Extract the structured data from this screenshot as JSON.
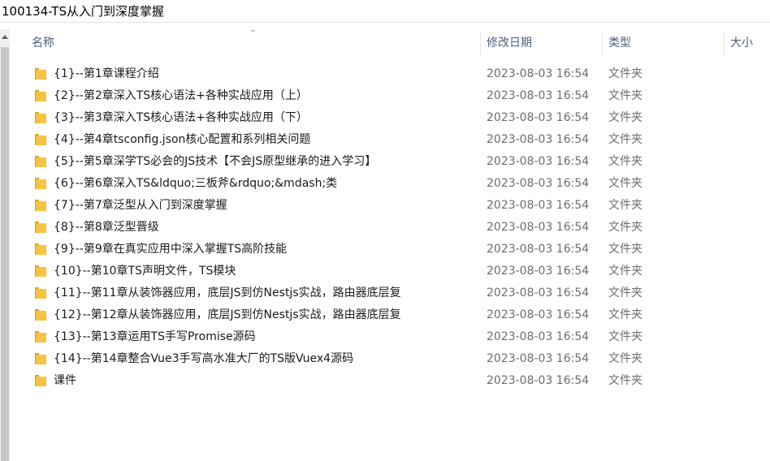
{
  "window": {
    "title": "100134-TS从入门到深度掌握"
  },
  "columns": {
    "name": "名称",
    "modified": "修改日期",
    "type": "类型",
    "size": "大小"
  },
  "colors": {
    "folder": "#f6c343",
    "folder_tab": "#e3a21a",
    "header_text": "#4c607a"
  },
  "icons": {
    "folder": "folder-icon",
    "sort": "sort-ascending-icon",
    "scroll_up": "scroll-up-arrow-icon"
  },
  "items": [
    {
      "name": "{1}--第1章课程介绍",
      "modified": "2023-08-03 16:54",
      "type": "文件夹"
    },
    {
      "name": "{2}--第2章深入TS核心语法+各种实战应用（上）",
      "modified": "2023-08-03 16:54",
      "type": "文件夹"
    },
    {
      "name": "{3}--第3章深入TS核心语法+各种实战应用（下）",
      "modified": "2023-08-03 16:54",
      "type": "文件夹"
    },
    {
      "name": "{4}--第4章tsconfig.json核心配置和系列相关问题",
      "modified": "2023-08-03 16:54",
      "type": "文件夹"
    },
    {
      "name": "{5}--第5章深学TS必会的JS技术【不会JS原型继承的进入学习】",
      "modified": "2023-08-03 16:54",
      "type": "文件夹"
    },
    {
      "name": "{6}--第6章深入TS&ldquo;三板斧&rdquo;&mdash;类",
      "modified": "2023-08-03 16:54",
      "type": "文件夹"
    },
    {
      "name": "{7}--第7章泛型从入门到深度掌握",
      "modified": "2023-08-03 16:54",
      "type": "文件夹"
    },
    {
      "name": "{8}--第8章泛型晋级",
      "modified": "2023-08-03 16:54",
      "type": "文件夹"
    },
    {
      "name": "{9}--第9章在真实应用中深入掌握TS高阶技能",
      "modified": "2023-08-03 16:54",
      "type": "文件夹"
    },
    {
      "name": "{10}--第10章TS声明文件，TS模块",
      "modified": "2023-08-03 16:54",
      "type": "文件夹"
    },
    {
      "name": "{11}--第11章从装饰器应用，底层JS到仿Nestjs实战，路由器底层复",
      "modified": "2023-08-03 16:54",
      "type": "文件夹"
    },
    {
      "name": "{12}--第12章从装饰器应用，底层JS到仿Nestjs实战，路由器底层复",
      "modified": "2023-08-03 16:54",
      "type": "文件夹"
    },
    {
      "name": "{13}--第13章运用TS手写Promise源码",
      "modified": "2023-08-03 16:54",
      "type": "文件夹"
    },
    {
      "name": "{14}--第14章整合Vue3手写高水准大厂的TS版Vuex4源码",
      "modified": "2023-08-03 16:54",
      "type": "文件夹"
    },
    {
      "name": "课件",
      "modified": "2023-08-03 16:54",
      "type": "文件夹"
    }
  ]
}
